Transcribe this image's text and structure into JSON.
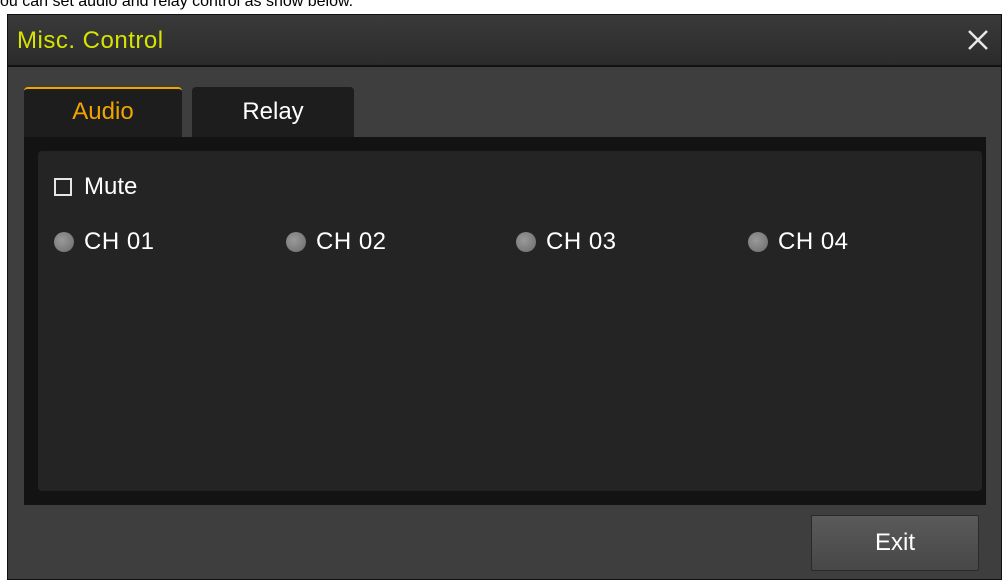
{
  "caption": "ou can set audio and relay control as show below.",
  "dialog": {
    "title": "Misc. Control",
    "close_icon": "close-icon"
  },
  "tabs": [
    {
      "label": "Audio",
      "active": true
    },
    {
      "label": "Relay",
      "active": false
    }
  ],
  "audio": {
    "mute": {
      "label": "Mute",
      "checked": false
    },
    "channels": [
      {
        "label": "CH 01",
        "selected": false
      },
      {
        "label": "CH 02",
        "selected": false
      },
      {
        "label": "CH 03",
        "selected": false
      },
      {
        "label": "CH 04",
        "selected": false
      }
    ]
  },
  "footer": {
    "exit_label": "Exit"
  },
  "colors": {
    "title": "#d7e400",
    "active_tab": "#f0a400",
    "background": "#3e3e3e",
    "panel": "#242424"
  }
}
